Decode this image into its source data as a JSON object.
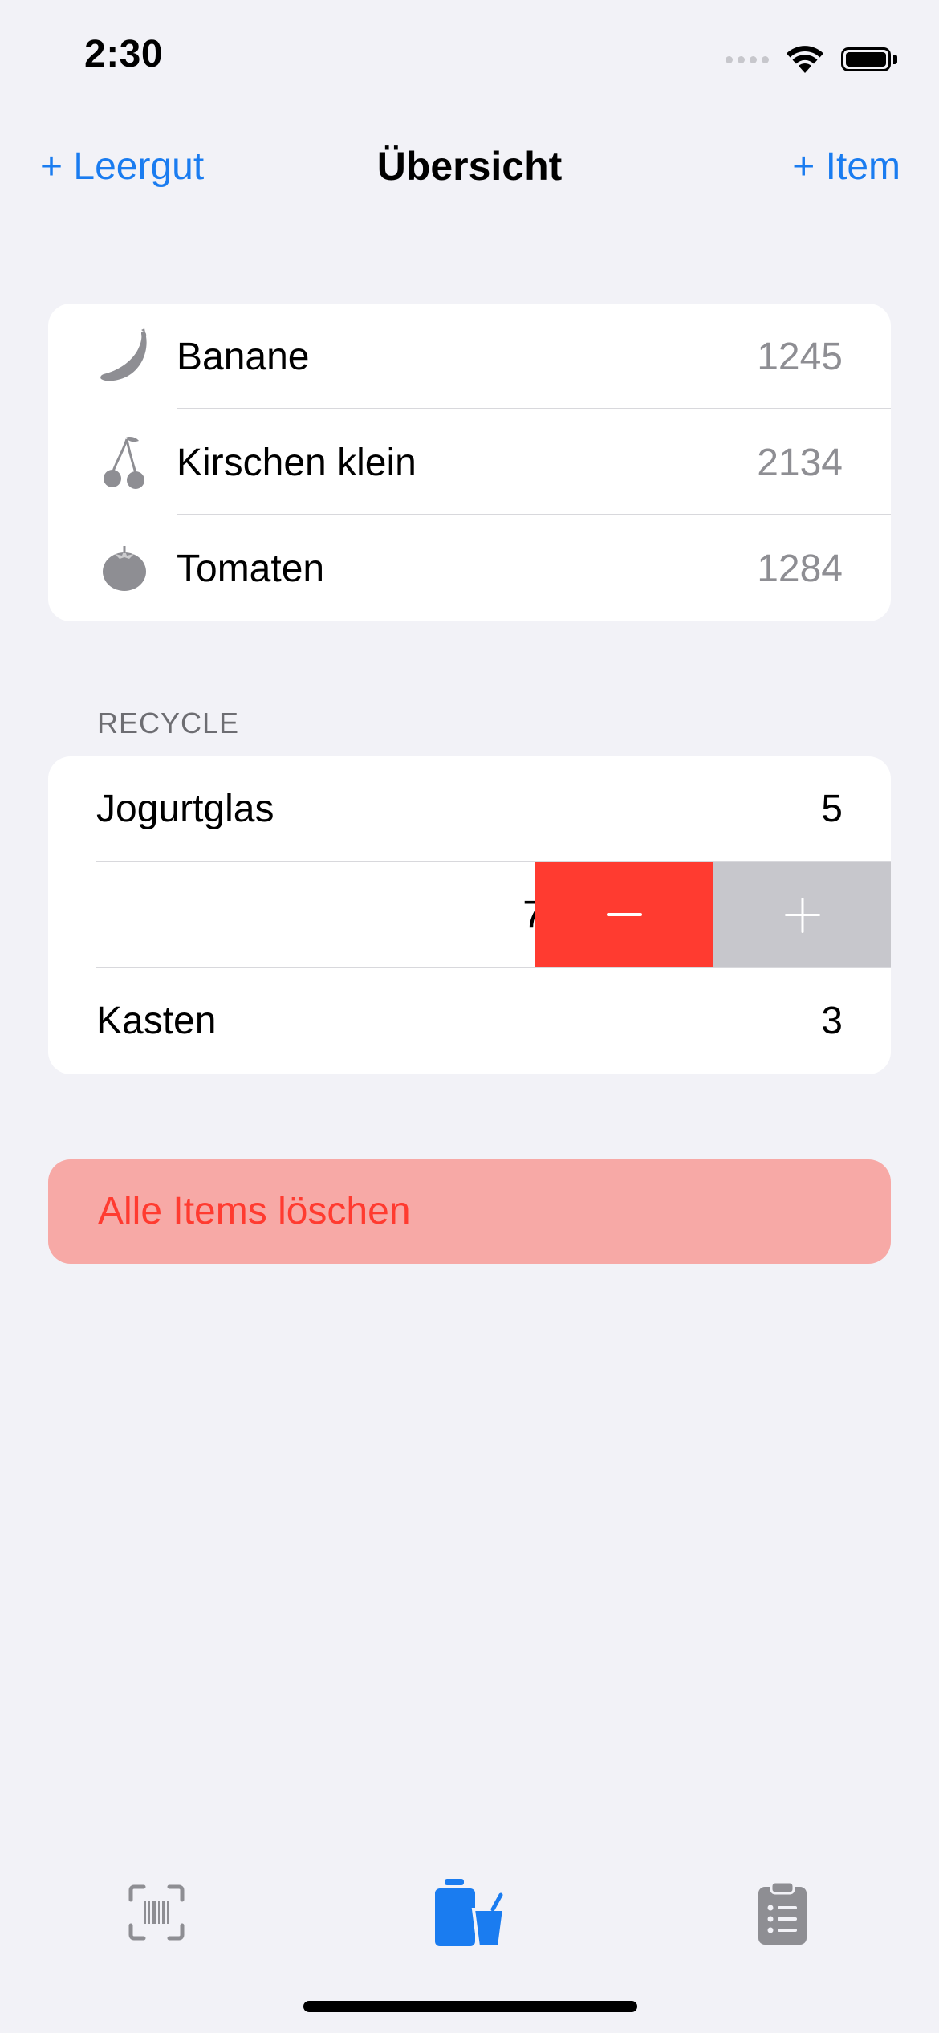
{
  "status_bar": {
    "time": "2:30"
  },
  "nav": {
    "left_label": "+ Leergut",
    "title": "Übersicht",
    "right_label": "+ Item"
  },
  "items": [
    {
      "icon": "banana-icon",
      "label": "Banane",
      "value": "1245"
    },
    {
      "icon": "cherries-icon",
      "label": "Kirschen klein",
      "value": "2134"
    },
    {
      "icon": "tomato-icon",
      "label": "Tomaten",
      "value": "1284"
    }
  ],
  "recycle": {
    "header": "RECYCLE",
    "rows": [
      {
        "label": "Jogurtglas",
        "value": "5"
      },
      {
        "label": "",
        "value": "7",
        "swiped": true,
        "actions": [
          "minus",
          "plus"
        ]
      },
      {
        "label": "Kasten",
        "value": "3"
      }
    ]
  },
  "delete_button": {
    "label": "Alle Items löschen"
  },
  "tabs": [
    {
      "icon": "barcode-scan-icon",
      "active": false
    },
    {
      "icon": "bottle-cup-icon",
      "active": true
    },
    {
      "icon": "clipboard-list-icon",
      "active": false
    }
  ],
  "colors": {
    "accent": "#1a7cf0",
    "destructive": "#ff3b30",
    "destructive_light": "#f7a9a6",
    "secondary_text": "#8e8e93",
    "background": "#f2f2f7",
    "inactive_icon": "#8e8e93"
  }
}
